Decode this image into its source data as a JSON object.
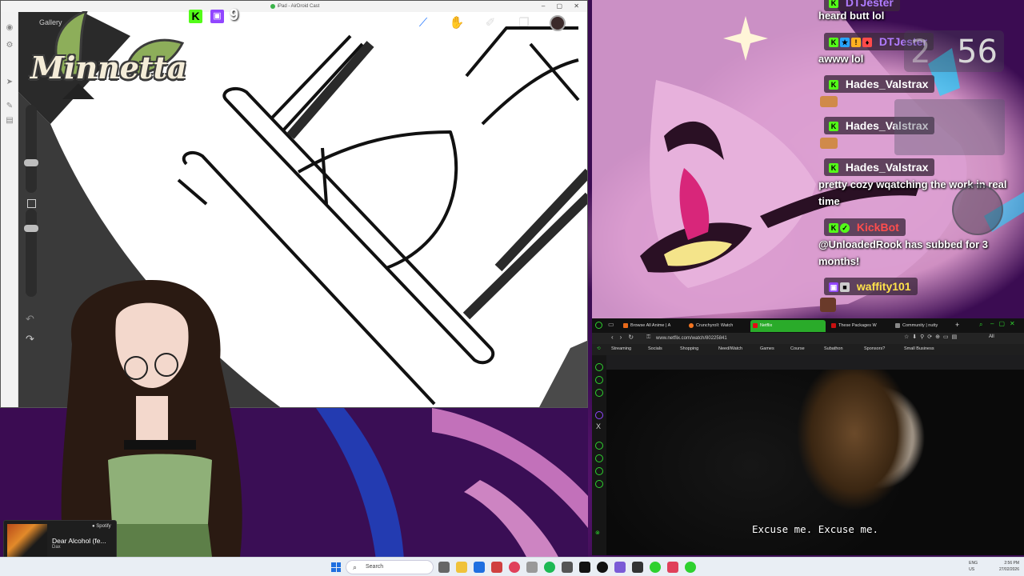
{
  "ipad_window": {
    "title": "iPad - AirDroid Cast",
    "gallery_label": "Gallery",
    "tools": [
      "brush-icon",
      "smudge-icon",
      "eraser-icon",
      "layers-icon"
    ],
    "color": "#3b2a2a"
  },
  "overlay": {
    "logo_text": "Minnetta",
    "viewer_count": "9"
  },
  "chat": {
    "messages": [
      {
        "user": "DTJester",
        "user_color": "#b07cff",
        "text": "heard butt lol",
        "badges": [
          "kick",
          "sub",
          "gift"
        ]
      },
      {
        "user": "DTJester",
        "user_color": "#b07cff",
        "text": "awww lol",
        "badges": [
          "kick",
          "sub",
          "gift",
          "bits"
        ]
      },
      {
        "user": "Hades_Valstrax",
        "user_color": "#ffffff",
        "text": "",
        "badges": [
          "kick"
        ]
      },
      {
        "user": "Hades_Valstrax",
        "user_color": "#ffffff",
        "text": "",
        "badges": [
          "kick"
        ]
      },
      {
        "user": "Hades_Valstrax",
        "user_color": "#ffffff",
        "text": "pretty cozy wqatching the work in real time",
        "badges": [
          "kick"
        ]
      },
      {
        "user": "KickBot",
        "user_color": "#ff4d4d",
        "text": "@UnloadedRook has subbed for 3 months!",
        "badges": [
          "kick",
          "verified"
        ]
      },
      {
        "user": "waffity101",
        "user_color": "#ffe24a",
        "text": "",
        "badges": [
          "twitch",
          "mod"
        ]
      }
    ],
    "clock": {
      "dim": "2",
      "bright": "56"
    }
  },
  "browser": {
    "tabs": [
      {
        "label": "Browse All Anime | A",
        "color": "#e86a1a"
      },
      {
        "label": "Crunchyroll: Watch",
        "color": "#f47521"
      },
      {
        "label": "Netflix",
        "color": "#e50914",
        "active": true
      },
      {
        "label": "These Packages W",
        "color": "#c81010"
      },
      {
        "label": "Community | nutty",
        "color": "#888888"
      }
    ],
    "url": "www.netflix.com/watch/80225841",
    "bookmarks": [
      "Streaming",
      "Socials",
      "Shopping",
      "Need/Watch",
      "Games",
      "Course",
      "Subathon",
      "Sponsors?",
      "Small Business"
    ],
    "subtitle": "Excuse me. Excuse me."
  },
  "spotify": {
    "brand": "Spotify",
    "title": "Dear Alcohol (fe...",
    "artist": "Dax",
    "progress": 0.75
  },
  "taskbar": {
    "search_placeholder": "Search",
    "lang": "ENG\nUS",
    "time": "2:56 PM",
    "date": "27/02/2026"
  }
}
